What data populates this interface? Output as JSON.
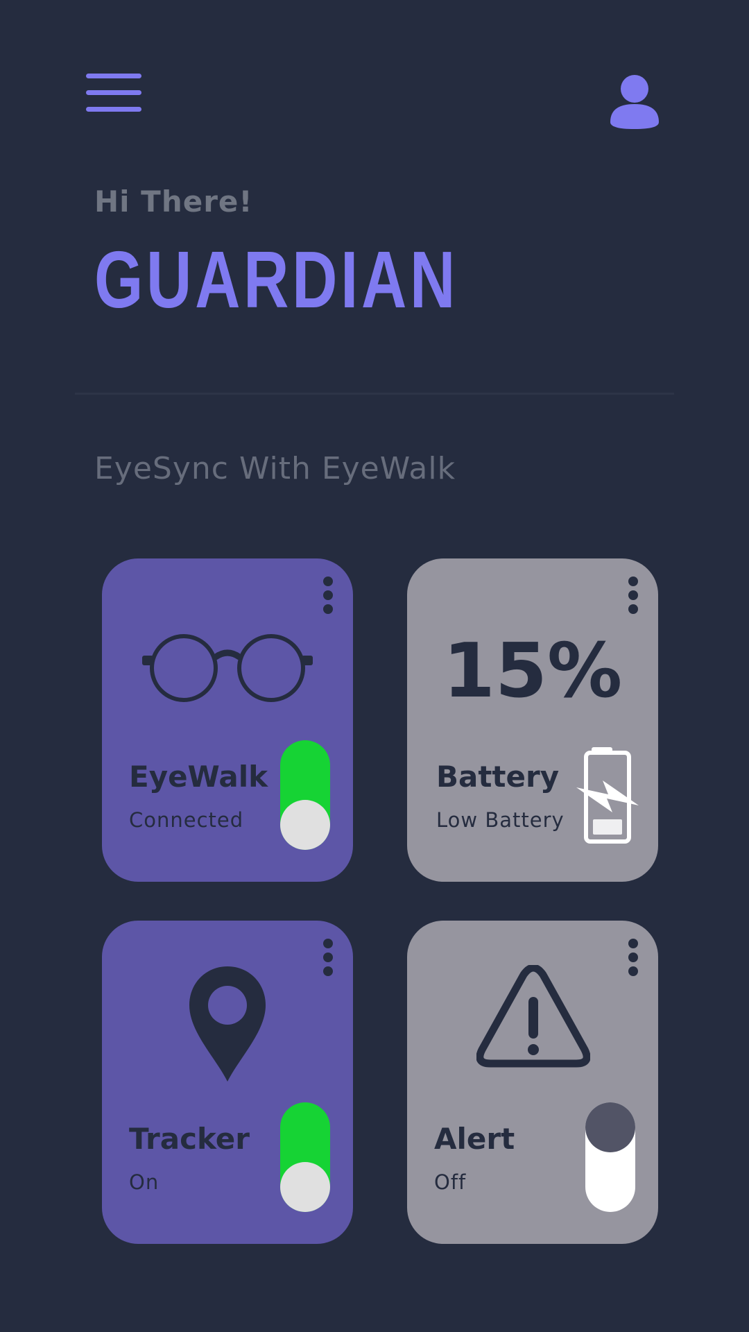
{
  "header": {
    "greeting": "Hi There!",
    "title": "GUARDIAN",
    "subtitle": "EyeSync With EyeWalk",
    "menu_icon": "hamburger-menu-icon",
    "profile_icon": "user-avatar-icon"
  },
  "cards": {
    "eyewalk": {
      "title": "EyeWalk",
      "status": "Connected",
      "icon": "glasses-icon",
      "toggle_on": true
    },
    "battery": {
      "title": "Battery",
      "status": "Low Battery",
      "value": "15%",
      "icon": "battery-charging-icon"
    },
    "tracker": {
      "title": "Tracker",
      "status": "On",
      "icon": "location-pin-icon",
      "toggle_on": true
    },
    "alert": {
      "title": "Alert",
      "status": "Off",
      "icon": "warning-triangle-icon",
      "toggle_on": false
    }
  },
  "colors": {
    "background": "#252c3f",
    "accent": "#7f7af0",
    "card_purple": "#5d56a7",
    "card_gray": "#96959f",
    "toggle_on": "#16d334"
  }
}
